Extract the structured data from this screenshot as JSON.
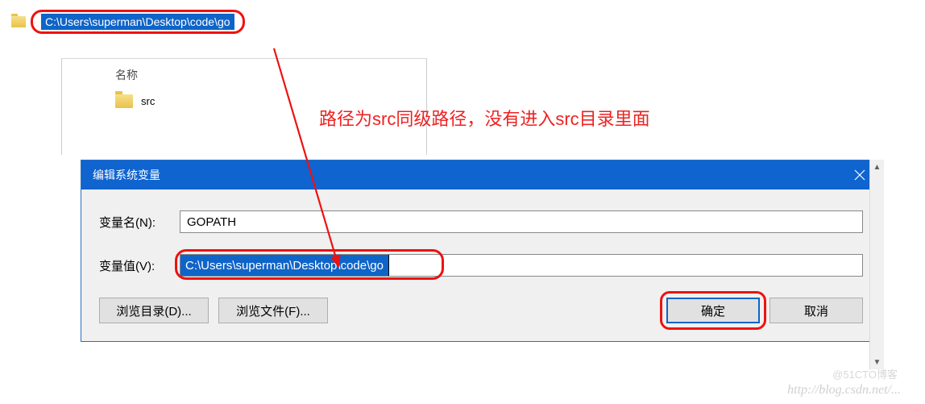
{
  "explorer": {
    "address": "C:\\Users\\superman\\Desktop\\code\\go",
    "header_name": "名称",
    "items": [
      {
        "name": "src"
      }
    ]
  },
  "annotation": "路径为src同级路径，没有进入src目录里面",
  "dialog": {
    "title": "编辑系统变量",
    "name_label": "变量名(N):",
    "name_value": "GOPATH",
    "value_label": "变量值(V):",
    "value_value": "C:\\Users\\superman\\Desktop\\code\\go",
    "browse_dir": "浏览目录(D)...",
    "browse_file": "浏览文件(F)...",
    "ok": "确定",
    "cancel": "取消"
  },
  "watermark": "http://blog.csdn.net/...",
  "watermark2": "@51CTO博客"
}
